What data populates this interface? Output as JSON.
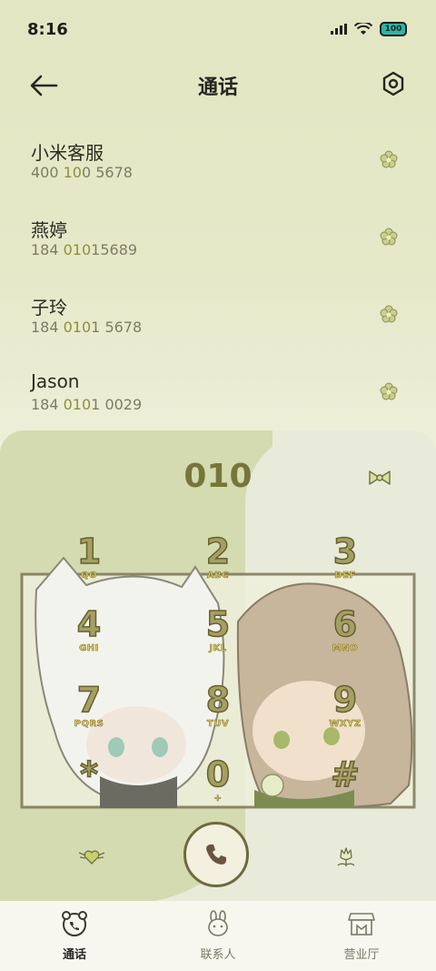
{
  "status": {
    "time": "8:16",
    "battery": "100"
  },
  "header": {
    "title": "通话"
  },
  "contacts": [
    {
      "name": "小米客服",
      "num_a": "400 ",
      "num_hl": "10",
      "num_b": "0 5678"
    },
    {
      "name": "燕婷",
      "num_a": "184 ",
      "num_hl": "010",
      "num_b": "15689"
    },
    {
      "name": "子玲",
      "num_a": "184 ",
      "num_hl": "010",
      "num_b": "1 5678"
    },
    {
      "name": "Jason",
      "num_a": "184 ",
      "num_hl": "010",
      "num_b": "1 0029"
    }
  ],
  "dialer": {
    "entered": "010"
  },
  "keys": [
    {
      "d": "1",
      "l": "QO"
    },
    {
      "d": "2",
      "l": "ABC"
    },
    {
      "d": "3",
      "l": "DEF"
    },
    {
      "d": "4",
      "l": "GHI"
    },
    {
      "d": "5",
      "l": "JKL"
    },
    {
      "d": "6",
      "l": "MNO"
    },
    {
      "d": "7",
      "l": "PQRS"
    },
    {
      "d": "8",
      "l": "TUV"
    },
    {
      "d": "9",
      "l": "WXYZ"
    },
    {
      "d": "*",
      "l": ""
    },
    {
      "d": "0",
      "l": "+"
    },
    {
      "d": "#",
      "l": ""
    }
  ],
  "nav": [
    {
      "label": "通话"
    },
    {
      "label": "联系人"
    },
    {
      "label": "营业厅"
    }
  ],
  "colors": {
    "accent": "#76763a",
    "bg": "#e4e8c8",
    "panel": "#d4dbb0"
  }
}
